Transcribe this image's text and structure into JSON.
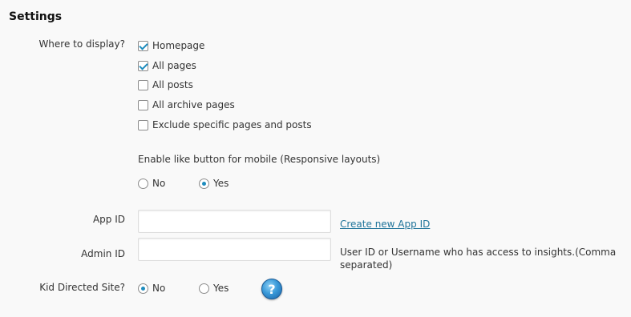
{
  "section_title": "Settings",
  "where_to_display": {
    "label": "Where to display?",
    "options": [
      {
        "label": "Homepage",
        "checked": true
      },
      {
        "label": "All pages",
        "checked": true
      },
      {
        "label": "All posts",
        "checked": false
      },
      {
        "label": "All archive pages",
        "checked": false
      },
      {
        "label": "Exclude specific pages and posts",
        "checked": false
      }
    ]
  },
  "mobile": {
    "label": "Enable like button for mobile (Responsive layouts)",
    "options": [
      {
        "label": "No",
        "selected": false
      },
      {
        "label": "Yes",
        "selected": true
      }
    ]
  },
  "app_id": {
    "label": "App ID",
    "value": "",
    "link": "Create new App ID"
  },
  "admin_id": {
    "label": "Admin ID",
    "value": "",
    "help_line1": "User ID or Username who has access to insights.(Comma",
    "help_line2": "separated)"
  },
  "kid_directed": {
    "label": "Kid Directed Site?",
    "options": [
      {
        "label": "No",
        "selected": true
      },
      {
        "label": "Yes",
        "selected": false
      }
    ],
    "help_icon": "question-icon",
    "help_glyph": "?"
  },
  "colors": {
    "accent": "#1e8cbe",
    "link": "#21759b"
  }
}
